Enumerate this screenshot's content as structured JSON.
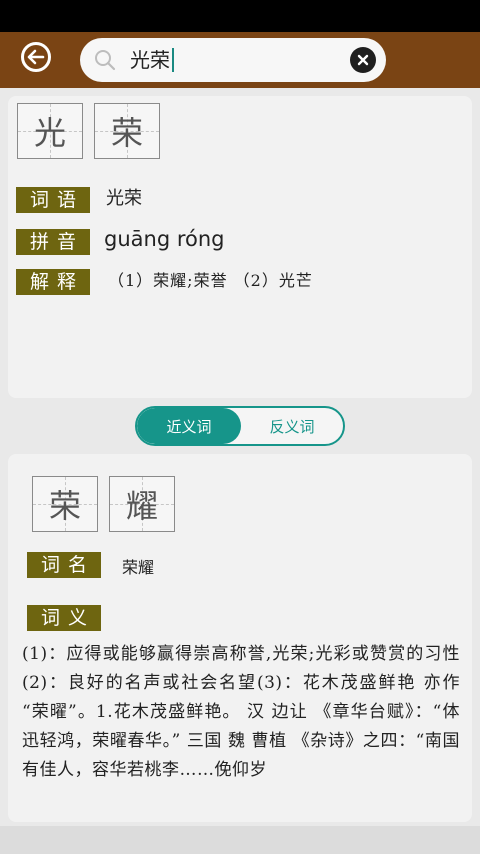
{
  "search": {
    "query": "光荣"
  },
  "word": {
    "characters": [
      "光",
      "荣"
    ],
    "ciyu_label": "词语",
    "ciyu_value": "光荣",
    "pinyin_label": "拼音",
    "pinyin_value": "guāng róng",
    "jieshi_label": "解释",
    "jieshi_value": "（1）荣耀;荣誉 （2）光芒"
  },
  "tabs": {
    "synonym": "近义词",
    "antonym": "反义词"
  },
  "synonym": {
    "characters": [
      "荣",
      "耀"
    ],
    "name_label": "词名",
    "name_value": "荣耀",
    "meaning_label": "词义",
    "meaning_text": "(1)：应得或能够赢得崇高称誉,光荣;光彩或赞赏的习性(2)：良好的名声或社会名望(3)：花木茂盛鲜艳 亦作 “荣曜”。1.花木茂盛鲜艳。 汉 边让 《章华台赋》：“体迅轻鸿，荣曜春华。” 三国 魏 曹植 《杂诗》之四：“南国有佳人，容华若桃李……俛仰岁"
  },
  "colors": {
    "topbar": "#7a4414",
    "label_bg": "#6e6510",
    "accent": "#16958a"
  }
}
